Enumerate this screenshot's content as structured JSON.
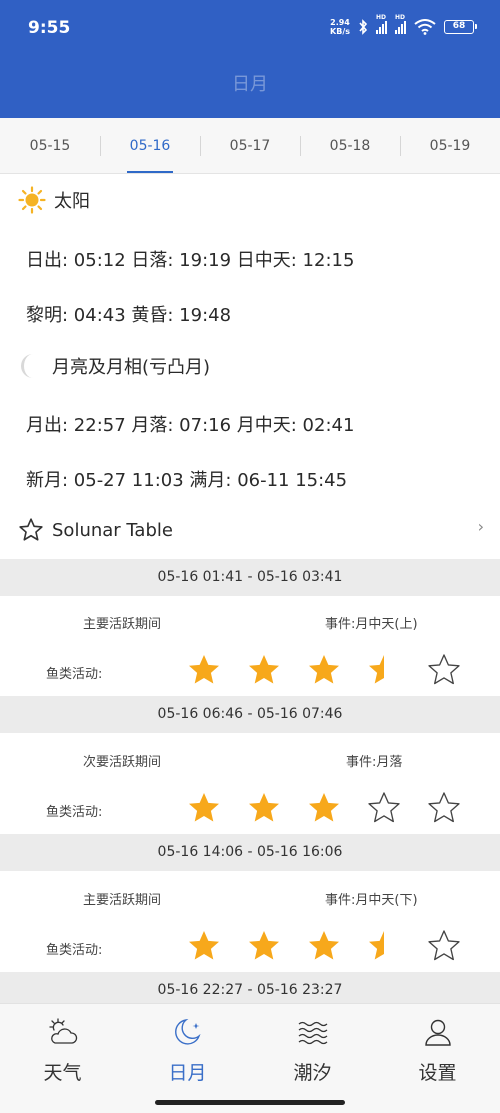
{
  "status_bar": {
    "time": "9:55",
    "net_speed": "2.94",
    "net_unit": "KB/s",
    "hd1": "HD",
    "hd2": "HD",
    "battery": "68"
  },
  "header": {
    "title": "日月"
  },
  "date_tabs": [
    "05-15",
    "05-16",
    "05-17",
    "05-18",
    "05-19"
  ],
  "active_tab": "05-16",
  "sun": {
    "title": "太阳",
    "line1": "日出: 05:12 日落: 19:19  日中天: 12:15",
    "line2": "黎明: 04:43 黄昏: 19:48"
  },
  "moon": {
    "title": "月亮及月相(亏凸月)",
    "line1": "月出: 22:57 月落: 07:16 月中天: 02:41",
    "line2": "新月: 05-27 11:03 满月: 06-11 15:45"
  },
  "solunar": {
    "title": "Solunar Table",
    "periods": [
      {
        "range": "05-16 01:41 - 05-16 03:41",
        "type": "主要活跃期间",
        "event": "事件:月中天(上)",
        "fish_label": "鱼类活动:",
        "rating": 3.5
      },
      {
        "range": "05-16 06:46 - 05-16 07:46",
        "type": "次要活跃期间",
        "event": "事件:月落",
        "fish_label": "鱼类活动:",
        "rating": 3
      },
      {
        "range": "05-16 14:06 - 05-16 16:06",
        "type": "主要活跃期间",
        "event": "事件:月中天(下)",
        "fish_label": "鱼类活动:",
        "rating": 3.5
      },
      {
        "range": "05-16 22:27 - 05-16 23:27"
      }
    ]
  },
  "colors": {
    "header": "#3060c4",
    "active": "#2f69c8",
    "star": "#f7a81b"
  },
  "bottom_nav": [
    {
      "label": "天气",
      "icon": "weather-icon"
    },
    {
      "label": "日月",
      "icon": "moon-icon"
    },
    {
      "label": "潮汐",
      "icon": "tide-icon"
    },
    {
      "label": "设置",
      "icon": "settings-icon"
    }
  ]
}
